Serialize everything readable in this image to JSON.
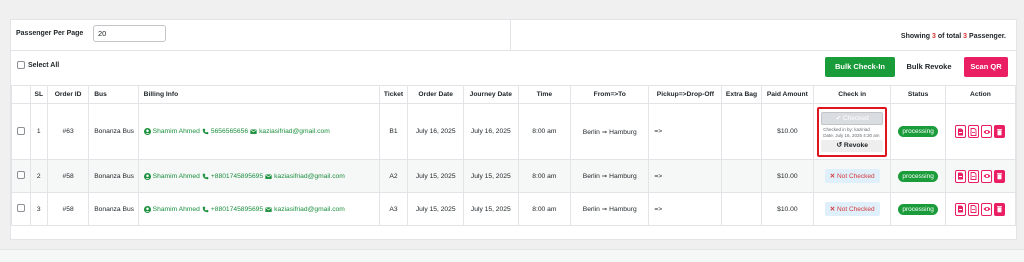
{
  "top": {
    "ppp_label": "Passenger Per Page",
    "ppp_value": "20",
    "showing_prefix": "Showing",
    "showing_count": "3",
    "showing_mid": "of total",
    "showing_total": "3",
    "showing_suffix": "Passenger."
  },
  "controls": {
    "select_all": "Select All",
    "bulk_checkin": "Bulk Check-In",
    "bulk_revoke": "Bulk Revoke",
    "scan_qr": "Scan QR"
  },
  "table": {
    "headers": [
      "SL",
      "Order ID",
      "Bus",
      "Billing Info",
      "Ticket",
      "Order Date",
      "Journey Date",
      "Time",
      "From=>To",
      "Pickup=>Drop-Off",
      "Extra Bag",
      "Paid Amount",
      "Check in",
      "Status",
      "Action"
    ],
    "rows": [
      {
        "sl": "1",
        "order_id": "#63",
        "bus": "Bonanza Bus",
        "name": "Shamim Ahmed",
        "phone": "5656565656",
        "email": "kaziasifriad@gmail.com",
        "ticket": "B1",
        "order_date": "July 16, 2025",
        "journey_date": "July 16, 2025",
        "time": "8:00 am",
        "from": "Berlin",
        "to": "Hamburg",
        "pickup": "=>",
        "extra_bag": "",
        "paid": "$10.00",
        "status": "processing",
        "checkin": {
          "state": "Checked",
          "by": "Checked in by: kaziriad",
          "date": "Date: July 16, 2025 4:30 am",
          "revoke": "Revoke"
        }
      },
      {
        "sl": "2",
        "order_id": "#58",
        "bus": "Bonanza Bus",
        "name": "Shamim Ahmed",
        "phone": "+8801745895695",
        "email": "kaziasifriad@gmail.com",
        "ticket": "A2",
        "order_date": "July 15, 2025",
        "journey_date": "July 15, 2025",
        "time": "8:00 am",
        "from": "Berlin",
        "to": "Hamburg",
        "pickup": "=>",
        "extra_bag": "",
        "paid": "$10.00",
        "status": "processing",
        "checkin": {
          "state": "Not Checked"
        }
      },
      {
        "sl": "3",
        "order_id": "#58",
        "bus": "Bonanza Bus",
        "name": "Shamim Ahmed",
        "phone": "+8801745895695",
        "email": "kaziasifriad@gmail.com",
        "ticket": "A3",
        "order_date": "July 15, 2025",
        "journey_date": "July 15, 2025",
        "time": "8:00 am",
        "from": "Berlin",
        "to": "Hamburg",
        "pickup": "=>",
        "extra_bag": "",
        "paid": "$10.00",
        "status": "processing",
        "checkin": {
          "state": "Not Checked"
        }
      }
    ]
  },
  "colors": {
    "accent_green": "#1a9c3a",
    "accent_pink": "#e91e63",
    "alert_red": "#d63638"
  },
  "icons": [
    "user-icon",
    "phone-icon",
    "envelope-icon",
    "check-icon",
    "undo-icon",
    "x-icon",
    "pdf-icon",
    "file-icon",
    "eye-icon",
    "trash-icon"
  ]
}
